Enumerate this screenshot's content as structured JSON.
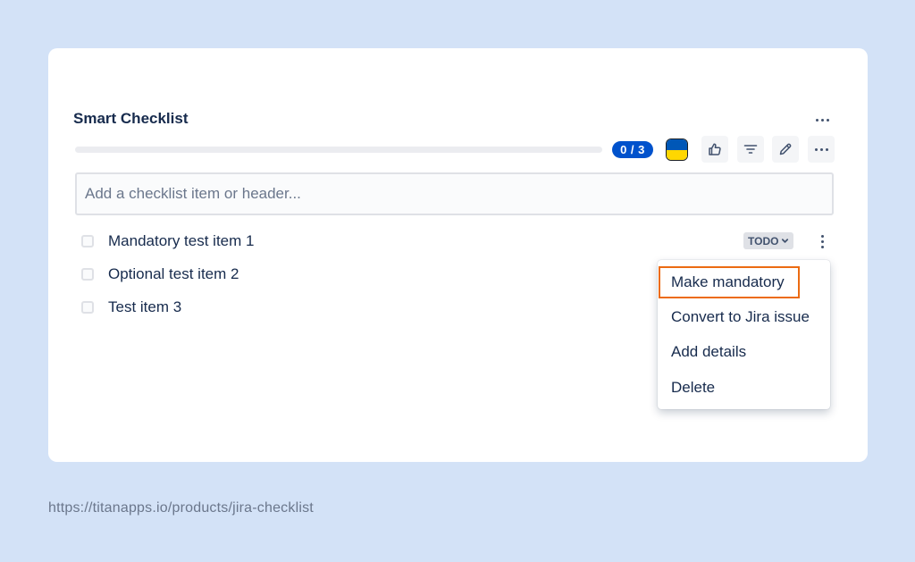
{
  "checklist": {
    "title": "Smart Checklist",
    "progress": {
      "completed": 0,
      "total": 3,
      "label": "0 / 3"
    },
    "input": {
      "placeholder": "Add a checklist item or header...",
      "value": ""
    },
    "items": [
      {
        "label": "Mandatory test item 1",
        "checked": false,
        "status": "TODO"
      },
      {
        "label": "Optional test item 2",
        "checked": false
      },
      {
        "label": "Test item 3",
        "checked": false
      }
    ],
    "context_menu": {
      "items": [
        {
          "label": "Make mandatory",
          "highlighted": true
        },
        {
          "label": "Convert to Jira issue"
        },
        {
          "label": "Add details"
        },
        {
          "label": "Delete"
        }
      ]
    }
  },
  "toolbar": {
    "icons": [
      "ukraine-flag-icon",
      "thumbs-up-icon",
      "filter-icon",
      "pencil-icon",
      "more-icon"
    ]
  },
  "footer": {
    "url": "https://titanapps.io/products/jira-checklist"
  },
  "colors": {
    "background": "#d3e2f7",
    "accent": "#0052cc",
    "highlight_border": "#ec6b12",
    "flag_blue": "#0057b7",
    "flag_yellow": "#ffd700"
  }
}
